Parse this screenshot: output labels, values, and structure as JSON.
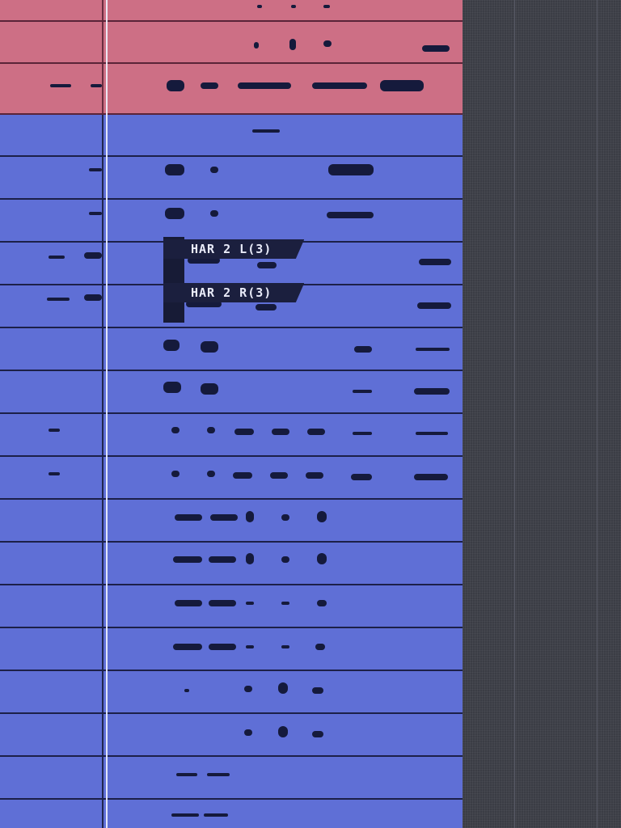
{
  "editor": {
    "clip_labels": [
      "HAR 2 L(3)",
      "HAR 2 R(3)"
    ],
    "colors": {
      "red_track": "#cd6f85",
      "blue_track": "#5f6fd6",
      "waveform": "#151a3c",
      "playhead": "#f2f4ff",
      "background": "#3b3d45"
    }
  }
}
